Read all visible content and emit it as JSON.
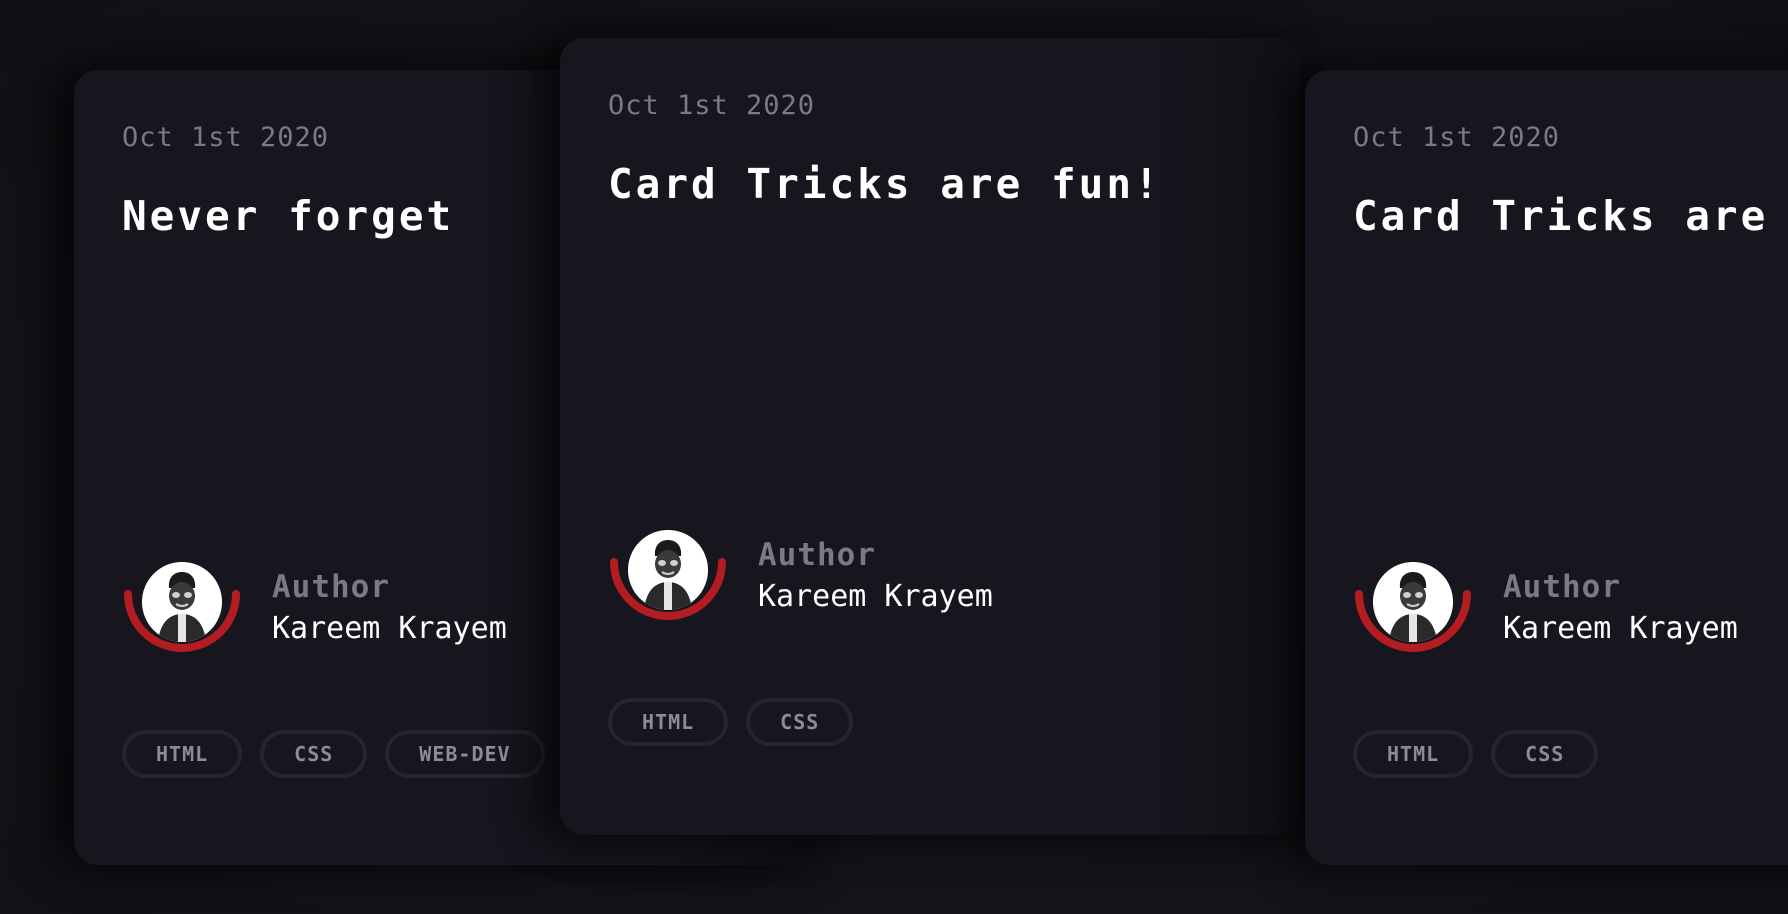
{
  "accent_color": "#b31d22",
  "cards": [
    {
      "date": "Oct 1st 2020",
      "title": "Never forget",
      "author_label": "Author",
      "author_name": "Kareem Krayem",
      "tags": [
        "HTML",
        "CSS",
        "WEB-DEV"
      ]
    },
    {
      "date": "Oct 1st 2020",
      "title": "Card Tricks are fun!",
      "author_label": "Author",
      "author_name": "Kareem Krayem",
      "tags": [
        "HTML",
        "CSS"
      ]
    },
    {
      "date": "Oct 1st 2020",
      "title": "Card Tricks are fun!",
      "author_label": "Author",
      "author_name": "Kareem Krayem",
      "tags": [
        "HTML",
        "CSS"
      ]
    }
  ]
}
